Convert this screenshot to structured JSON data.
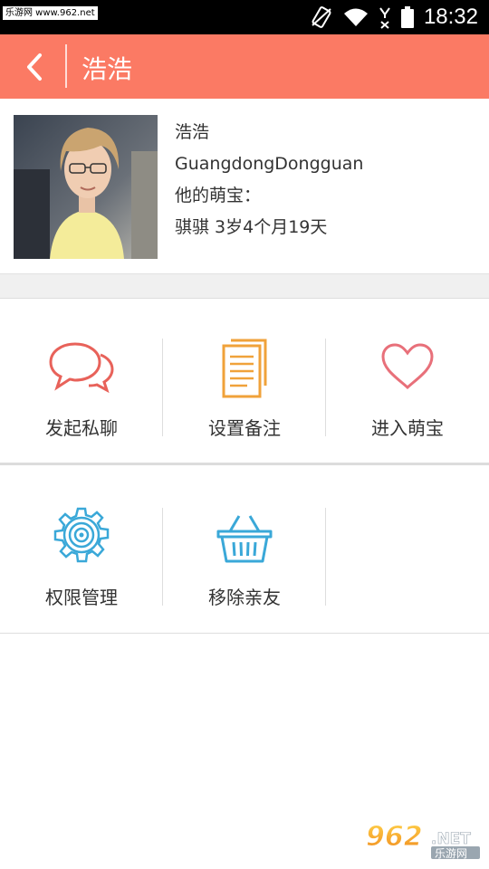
{
  "status_bar": {
    "watermark": "乐游网 www.962.net",
    "time": "18:32"
  },
  "header": {
    "title": "浩浩"
  },
  "profile": {
    "name": "浩浩",
    "location": "GuangdongDongguan",
    "baby_label": "他的萌宝：",
    "baby_info": "骐骐 3岁4个月19天"
  },
  "actions": [
    {
      "label": "发起私聊",
      "icon": "chat-bubbles-icon",
      "color": "#e8625a"
    },
    {
      "label": "设置备注",
      "icon": "document-icon",
      "color": "#f0a23a"
    },
    {
      "label": "进入萌宝",
      "icon": "heart-icon",
      "color": "#e8707a"
    },
    {
      "label": "权限管理",
      "icon": "gear-icon",
      "color": "#3aa8d8"
    },
    {
      "label": "移除亲友",
      "icon": "basket-icon",
      "color": "#3aa8d8"
    }
  ],
  "watermark_bottom": {
    "number": "962",
    "suffix": ".NET",
    "text": "乐游网"
  },
  "colors": {
    "header": "#fb7a64",
    "separator": "#f0f0f0"
  }
}
